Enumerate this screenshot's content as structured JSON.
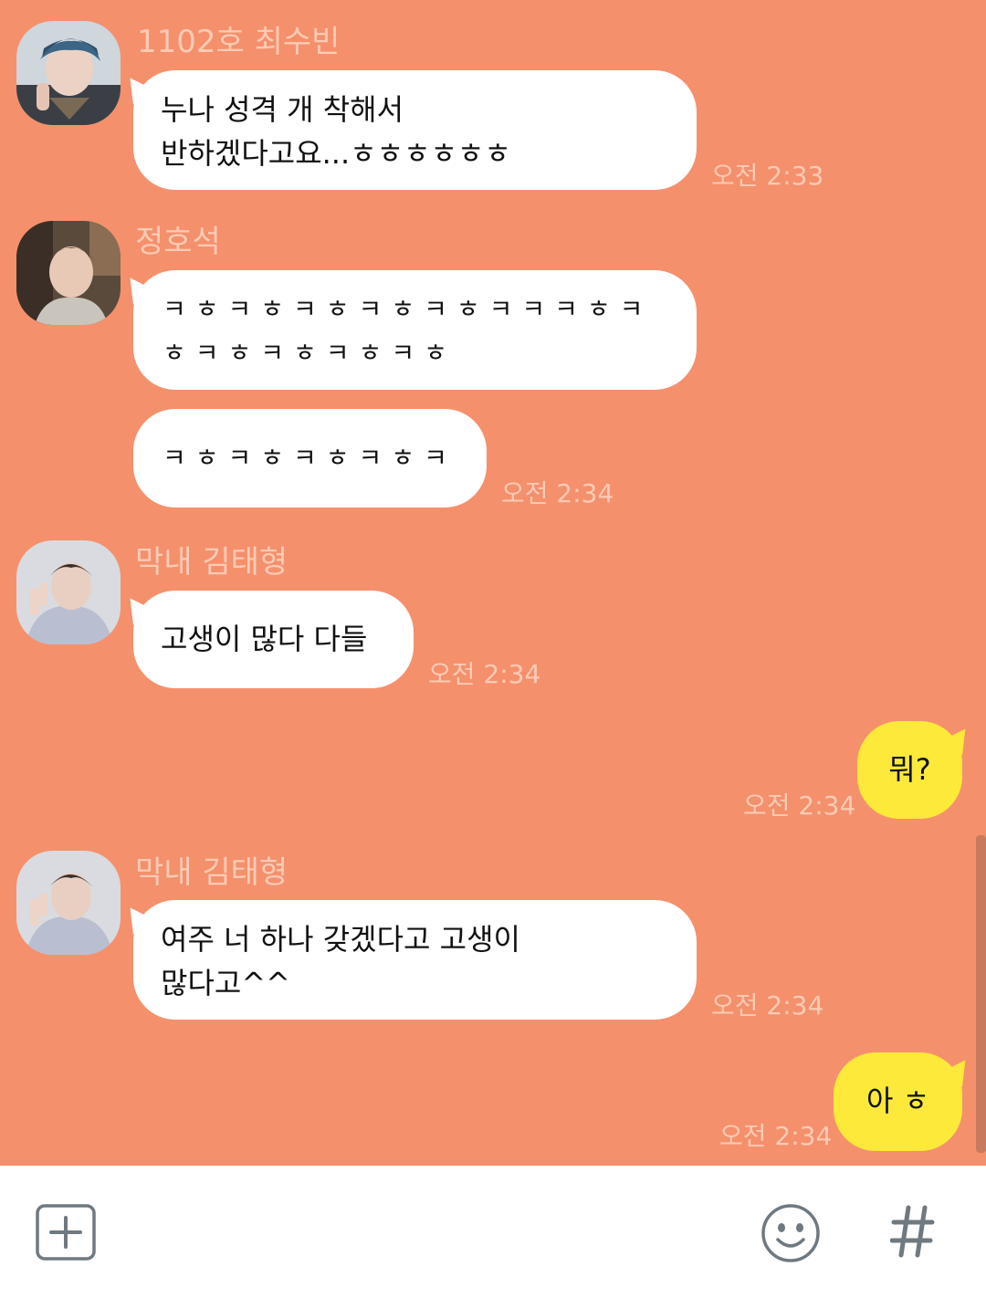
{
  "colors": {
    "background": "#f5906c",
    "bubble_incoming": "#ffffff",
    "bubble_outgoing": "#fde93a",
    "meta_text": "#fbcbb6"
  },
  "messages": [
    {
      "sender": "1102호 최수빈",
      "text": "누나 성격 개 착해서\n반하겠다고요...ㅎㅎㅎㅎㅎㅎ",
      "time": "오전 2:33"
    },
    {
      "sender": "정호석",
      "text": "ㅋㅎㅋㅎㅋㅎㅋㅎㅋㅎㅋㅋㅋㅎㅋ\nㅎㅋㅎㅋㅎㅋㅎㅋㅎ",
      "time": ""
    },
    {
      "sender": "",
      "text": "ㅋㅎㅋㅎㅋㅎㅋㅎㅋ",
      "time": "오전 2:34"
    },
    {
      "sender": "막내 김태형",
      "text": "고생이 많다 다들",
      "time": "오전 2:34"
    },
    {
      "sender": "me",
      "text": "뭐?",
      "time": "오전 2:34"
    },
    {
      "sender": "막내 김태형",
      "text": "여주 너 하나 갖겠다고 고생이\n많다고^^",
      "time": "오전 2:34"
    },
    {
      "sender": "me",
      "text": "아 ㅎ",
      "time": "오전 2:34"
    }
  ],
  "input_bar": {
    "plus_icon": "plus-square-icon",
    "emoji_icon": "smiley-icon",
    "hash_icon": "hash-icon"
  }
}
